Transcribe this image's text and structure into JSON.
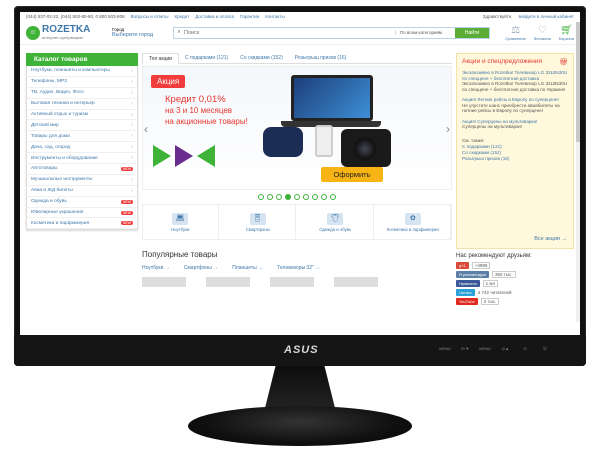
{
  "topbar": {
    "phones": "(044) 537-02-22, (044) 503-80-80, 0 800 503-808",
    "links": [
      "Вопросы и ответы",
      "Кредит",
      "Доставка и оплата",
      "Гарантия",
      "Контакты"
    ],
    "greeting": "Здравствуйте,",
    "login": "войдите в личный кабинет"
  },
  "header": {
    "logo_name": "ROZETKA",
    "logo_sub": "интернет-супермаркет",
    "city_label": "Город",
    "city_select": "Выберите город",
    "search_placeholder": "Поиск",
    "search_category": "По всем категориям",
    "search_button": "Найти",
    "compare": "Сравнение",
    "wishlist": "Желания",
    "cart": "Корзина"
  },
  "sidebar": {
    "title": "Каталог товаров",
    "items": [
      {
        "label": "Ноутбуки, планшеты и компьютеры",
        "new": false
      },
      {
        "label": "Телефоны, MP3",
        "new": false
      },
      {
        "label": "ТВ, Аудио, Видео, Фото",
        "new": false
      },
      {
        "label": "Бытовая техника и интерьер",
        "new": false
      },
      {
        "label": "Активный отдых и туризм",
        "new": false
      },
      {
        "label": "Детский мир",
        "new": false
      },
      {
        "label": "Товары для дома",
        "new": false
      },
      {
        "label": "Дача, сад, огород",
        "new": false
      },
      {
        "label": "Инструменты и оборудование",
        "new": false
      },
      {
        "label": "Автотовары",
        "new": true
      },
      {
        "label": "Музыкальные инструменты",
        "new": false
      },
      {
        "label": "Авиа и ЖД билеты",
        "new": false
      },
      {
        "label": "Одежда и обувь",
        "new": true
      },
      {
        "label": "Ювелирные украшения",
        "new": true
      },
      {
        "label": "Косметика и парфюмерия",
        "new": true
      }
    ],
    "new_label": "NEW"
  },
  "tabs": [
    "Топ акции",
    "С подарками (121)",
    "Со скидками (152)",
    "Розыгрыш призов (16)"
  ],
  "banner": {
    "badge": "Акция",
    "title": "Кредит 0,01%",
    "line1": "на 3 и 10 месяцев",
    "line2": "на акционные товары!",
    "button": "Оформить",
    "slides_total": 9,
    "active_slide": 3
  },
  "quick_links": [
    {
      "label": "Ноутбуки"
    },
    {
      "label": "Смартфоны"
    },
    {
      "label": "Одежда и обувь"
    },
    {
      "label": "Косметика и парфюмерия"
    }
  ],
  "popular": {
    "title": "Популярные товары",
    "categories": [
      "Ноутбуки →",
      "Смартфоны →",
      "Планшеты →",
      "Телевизоры 32\" →"
    ]
  },
  "promo": {
    "title": "Акции и спецпредложения",
    "items": [
      {
        "link": "Эксклюзивно в Rozetka! Телевизор LG 32LB530U по спеццене + бесплатная доставка",
        "text": "Эксклюзивно в Rozetka! Телевизор LG 32LB530U по спеццене + бесплатная доставка по Украине!"
      },
      {
        "link": "Акция! Летние рейсы в Европу по суперцене!",
        "text": "Не упустите шанс приобрести авиабилеты на летние рейсы в Европу по суперцене!"
      },
      {
        "link": "Акция! Суперцены на мультиварки!",
        "text": "Суперцены на мультиварки!"
      }
    ],
    "see_also": "См. также:",
    "links": [
      "С подарками (121)",
      "Со скидками (152)",
      "Розыгрыш призов (16)"
    ],
    "all": "Все акции →"
  },
  "social": {
    "title": "Нас рекомендуют друзьям:",
    "gplus_count": "+4998",
    "vk_label": "Я рекомендую",
    "vk_count": "350 тыс.",
    "fb_label": "Нравится",
    "fb_count": "1 мл",
    "tw_label": "Читать",
    "tw_count": "4 742 читателей",
    "yt_label": "YouTube",
    "yt_count": "2 тыс."
  },
  "monitor": {
    "brand": "ASUS",
    "controls": [
      "MENU",
      "⊙/▼",
      "MENU",
      "◁/▲",
      "⊙",
      "⏻"
    ]
  }
}
